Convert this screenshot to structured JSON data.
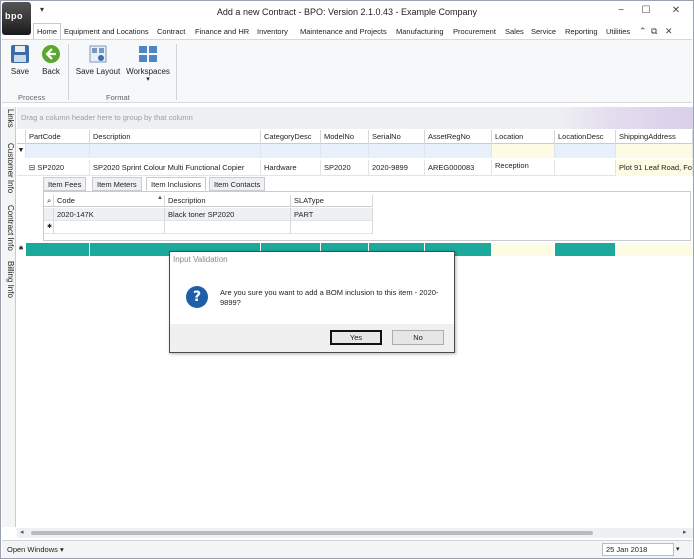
{
  "window": {
    "title": "Add a new Contract - BPO: Version 2.1.0.43 - Example Company",
    "logo_text": "bpo",
    "controls": [
      "minimize-icon",
      "maximize-icon",
      "close-icon"
    ]
  },
  "menu": {
    "tabs": [
      "Home",
      "Equipment and Locations",
      "Contract",
      "Finance and HR",
      "Inventory",
      "Maintenance and Projects",
      "Manufacturing",
      "Procurement",
      "Sales",
      "Service",
      "Reporting",
      "Utilities"
    ],
    "active": "Home"
  },
  "ribbon": {
    "save_label": "Save",
    "back_label": "Back",
    "save_layout_label": "Save Layout",
    "workspaces_label": "Workspaces",
    "group_process": "Process",
    "group_format": "Format"
  },
  "side_tabs": [
    "Links",
    "Customer Info",
    "Contract Info",
    "Billing Info"
  ],
  "grid": {
    "group_hint": "Drag a column header here to group by that column",
    "columns": [
      "PartCode",
      "Description",
      "CategoryDesc",
      "ModelNo",
      "SerialNo",
      "AssetRegNo",
      "Location",
      "LocationDesc",
      "ShippingAddress"
    ],
    "row": {
      "PartCode": "SP2020",
      "Description": "SP2020 Sprint Colour Multi Functional Copier",
      "CategoryDesc": "Hardware",
      "ModelNo": "SP2020",
      "SerialNo": "2020-9899",
      "AssetRegNo": "AREG000083",
      "Location": "Reception",
      "LocationDesc": "",
      "ShippingAddress": "Plot 91 Leaf Road, Fo"
    },
    "expand_symbol": "⊟"
  },
  "detail": {
    "tabs": [
      "Item Fees",
      "Item Meters",
      "Item Inclusions",
      "Item Contacts"
    ],
    "active_tab": "Item Inclusions",
    "columns": [
      "Code",
      "Description",
      "SLAType"
    ],
    "rows": [
      {
        "Code": "2020-147K",
        "Description": "Black toner SP2020",
        "SLAType": "PART"
      }
    ]
  },
  "status": {
    "open_windows": "Open Windows ▾",
    "date": "25 Jan 2018"
  },
  "dialog": {
    "title": "Input Validation",
    "icon": "question-icon",
    "message": "Are you sure you want to add a BOM inclusion to this item - 2020-9899?",
    "yes_label": "Yes",
    "no_label": "No"
  },
  "colors": {
    "teal": "#1aa99a",
    "filter_yellow": "#fdfbe3",
    "filter_blue": "#e8f1fb",
    "ribbon_bg": "#f7f8f9"
  }
}
